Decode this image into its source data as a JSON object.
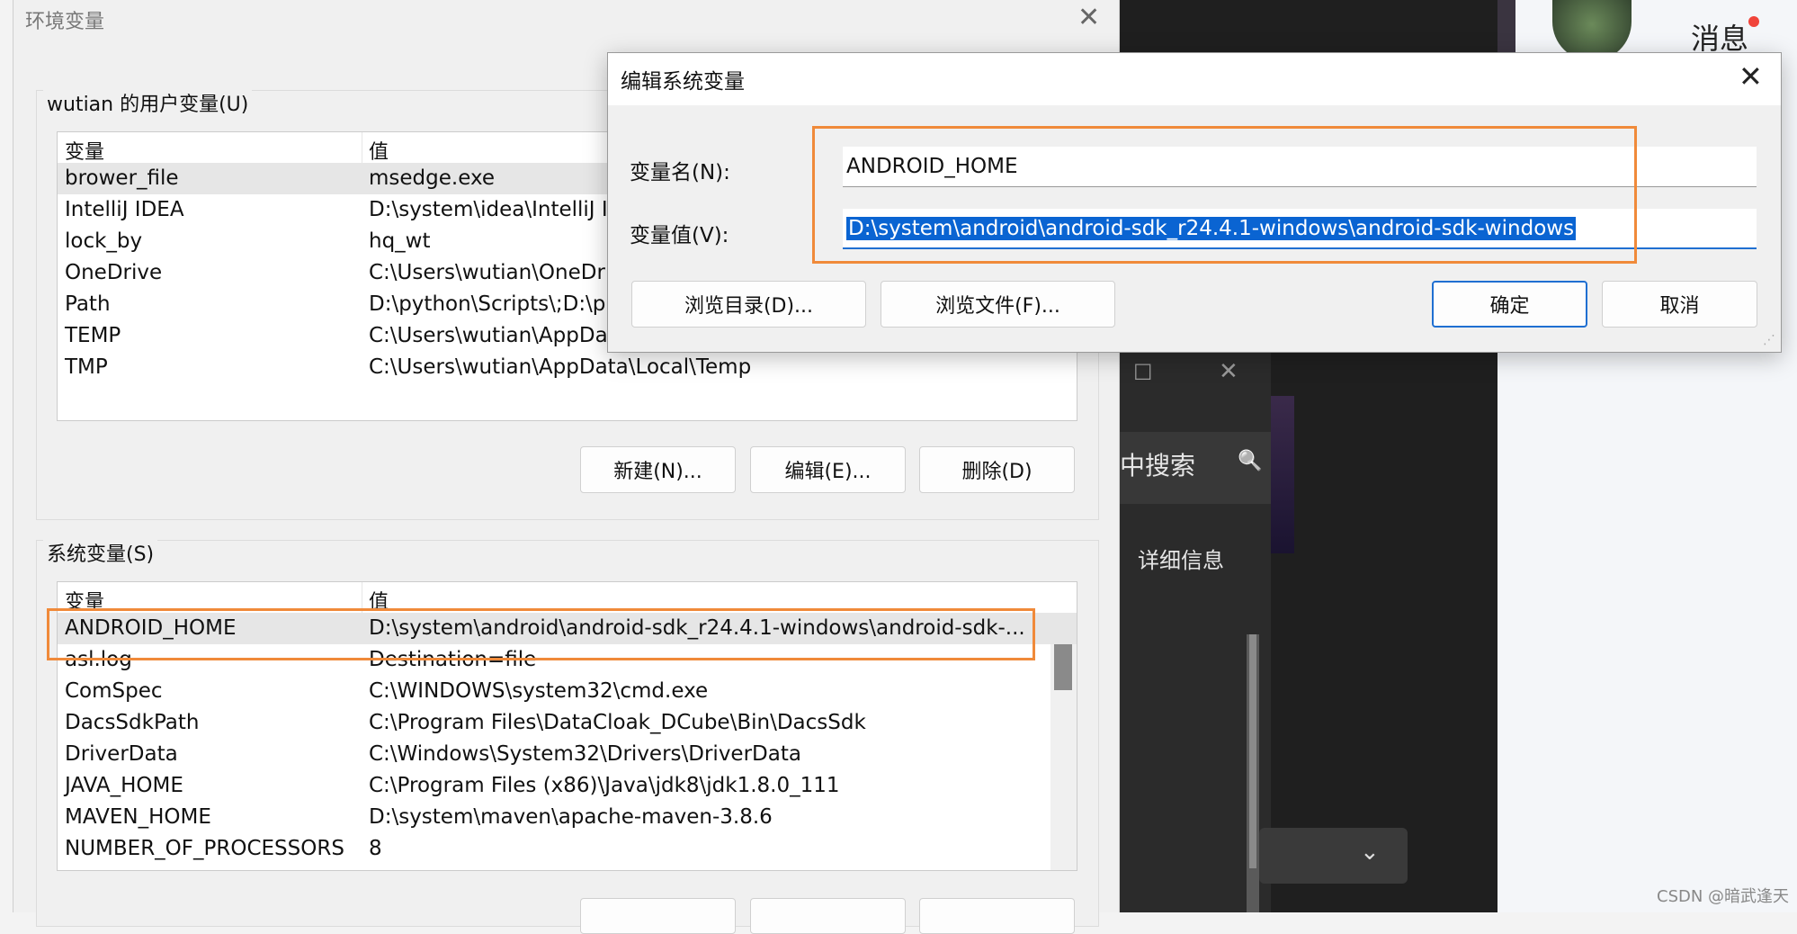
{
  "env_window": {
    "title": "环境变量",
    "close_glyph": "✕",
    "user_group_label": "wutian 的用户变量(U)",
    "columns": {
      "name": "变量",
      "value": "值"
    },
    "user_vars": [
      {
        "name": "brower_file",
        "value": "msedge.exe"
      },
      {
        "name": "IntelliJ IDEA",
        "value": "D:\\system\\idea\\IntelliJ I"
      },
      {
        "name": "lock_by",
        "value": "hq_wt"
      },
      {
        "name": "OneDrive",
        "value": "C:\\Users\\wutian\\OneDr"
      },
      {
        "name": "Path",
        "value": "D:\\python\\Scripts\\;D:\\p"
      },
      {
        "name": "TEMP",
        "value": "C:\\Users\\wutian\\AppDa"
      },
      {
        "name": "TMP",
        "value": "C:\\Users\\wutian\\AppData\\Local\\Temp"
      }
    ],
    "user_buttons": {
      "new": "新建(N)...",
      "edit": "编辑(E)...",
      "delete": "删除(D)"
    },
    "system_group_label": "系统变量(S)",
    "system_vars": [
      {
        "name": "ANDROID_HOME",
        "value": "D:\\system\\android\\android-sdk_r24.4.1-windows\\android-sdk-..."
      },
      {
        "name": "asl.log",
        "value": "Destination=file"
      },
      {
        "name": "ComSpec",
        "value": "C:\\WINDOWS\\system32\\cmd.exe"
      },
      {
        "name": "DacsSdkPath",
        "value": "C:\\Program Files\\DataCloak_DCube\\Bin\\DacsSdk"
      },
      {
        "name": "DriverData",
        "value": "C:\\Windows\\System32\\Drivers\\DriverData"
      },
      {
        "name": "JAVA_HOME",
        "value": "C:\\Program Files (x86)\\Java\\jdk8\\jdk1.8.0_111"
      },
      {
        "name": "MAVEN_HOME",
        "value": "D:\\system\\maven\\apache-maven-3.8.6"
      },
      {
        "name": "NUMBER_OF_PROCESSORS",
        "value": "8"
      }
    ]
  },
  "edit_dialog": {
    "title": "编辑系统变量",
    "close_glyph": "✕",
    "name_label": "变量名(N):",
    "name_value": "ANDROID_HOME",
    "value_label": "变量值(V):",
    "value_value": "D:\\system\\android\\android-sdk_r24.4.1-windows\\android-sdk-windows",
    "browse_dir": "浏览目录(D)...",
    "browse_file": "浏览文件(F)...",
    "ok": "确定",
    "cancel": "取消"
  },
  "background_app": {
    "message_label": "消息",
    "search_text": "中搜索",
    "detail_text": "详细信息",
    "minimize_glyph": "☐",
    "close_glyph": "✕",
    "search_glyph": "🔍",
    "chevron_glyph": "⌄",
    "watermark": "CSDN @暗武逢天"
  },
  "colors": {
    "highlight": "#f08a3a",
    "selection": "#0a64d2",
    "accent": "#1f6fd1"
  }
}
